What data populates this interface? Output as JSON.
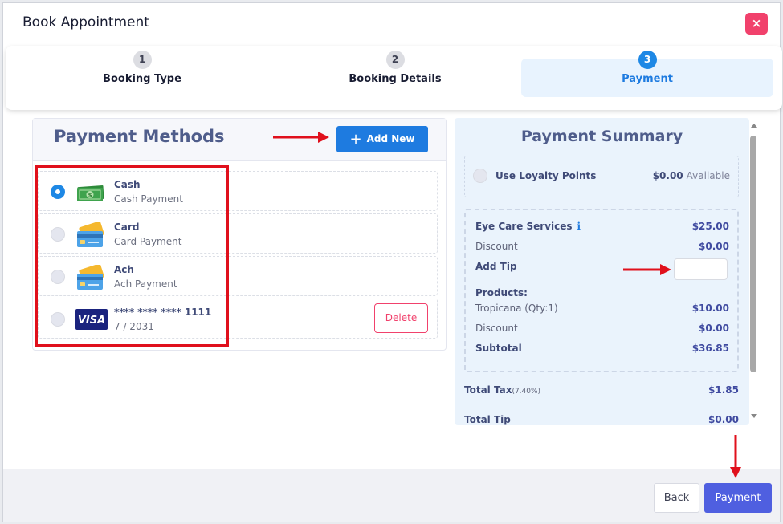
{
  "dialog": {
    "title": "Book Appointment",
    "close_label": "×"
  },
  "stepper": {
    "steps": [
      {
        "number": "1",
        "label": "Booking Type"
      },
      {
        "number": "2",
        "label": "Booking Details"
      },
      {
        "number": "3",
        "label": "Payment",
        "active": true
      }
    ]
  },
  "payment_methods": {
    "title": "Payment Methods",
    "add_new_label": "Add New",
    "items": [
      {
        "name": "Cash",
        "subtitle": "Cash Payment",
        "icon": "cash-icon",
        "selected": true
      },
      {
        "name": "Card",
        "subtitle": "Card Payment",
        "icon": "card-icon",
        "selected": false
      },
      {
        "name": "Ach",
        "subtitle": "Ach Payment",
        "icon": "ach-icon",
        "selected": false
      },
      {
        "name": "**** **** **** 1111",
        "subtitle": "7 / 2031",
        "icon": "visa-icon",
        "brand_text": "VISA",
        "selected": false,
        "delete_label": "Delete"
      }
    ]
  },
  "summary": {
    "title": "Payment Summary",
    "loyalty": {
      "label": "Use Loyalty Points",
      "value": "$0.00",
      "suffix": "Available"
    },
    "service": {
      "label": "Eye Care Services",
      "info_glyph": "i",
      "value": "$25.00"
    },
    "discount1": {
      "label": "Discount",
      "value": "$0.00"
    },
    "add_tip": {
      "label": "Add Tip",
      "value": ""
    },
    "products_heading": "Products:",
    "product": {
      "label": "Tropicana (Qty:1)",
      "value": "$10.00"
    },
    "discount2": {
      "label": "Discount",
      "value": "$0.00"
    },
    "subtotal": {
      "label": "Subtotal",
      "value": "$36.85"
    },
    "total_tax": {
      "label": "Total Tax",
      "rate": "(7.40%)",
      "value": "$1.85"
    },
    "total_tip": {
      "label": "Total Tip",
      "value": "$0.00"
    }
  },
  "footer": {
    "back_label": "Back",
    "payment_label": "Payment"
  },
  "colors": {
    "primary": "#1e7be0",
    "danger": "#f1416c",
    "payment_button": "#4f5fe0",
    "annotation": "#e0101c"
  }
}
